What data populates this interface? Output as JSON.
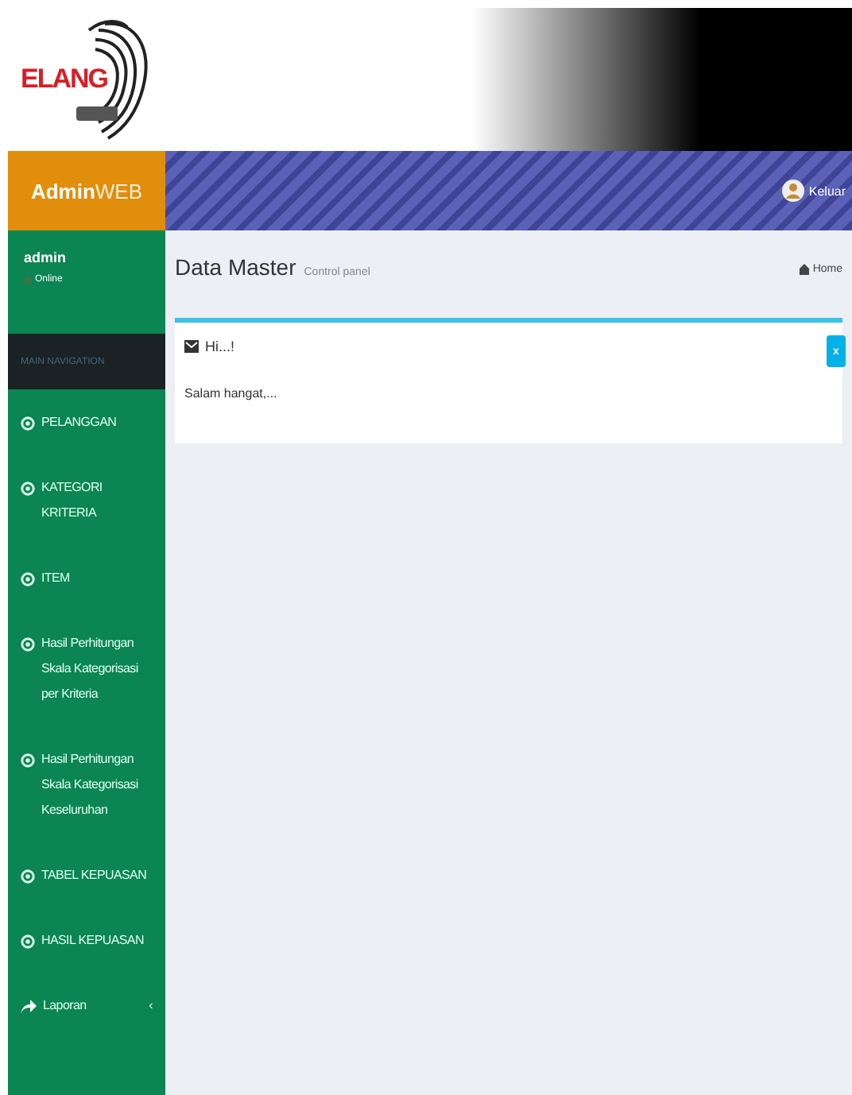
{
  "banner": {
    "logo_text": "ELANG"
  },
  "navbar": {
    "brand_bold": "Admin",
    "brand_light": "WEB",
    "user_label": "Keluar"
  },
  "sidebar": {
    "user": {
      "name": "admin",
      "status": "Online",
      "online": true
    },
    "header": "MAIN NAVIGATION",
    "items": [
      {
        "kind": "circle",
        "label": "PELANGGAN"
      },
      {
        "kind": "circle",
        "label": "KATEGORI KRITERIA"
      },
      {
        "kind": "circle",
        "label": "ITEM"
      },
      {
        "kind": "circle",
        "label": "Hasil Perhitungan Skala Kategorisasi per Kriteria"
      },
      {
        "kind": "circle",
        "label": "Hasil Perhitungan Skala Kategorisasi Keseluruhan"
      },
      {
        "kind": "circle",
        "label": "TABEL KEPUASAN"
      },
      {
        "kind": "circle",
        "label": "HASIL KEPUASAN"
      },
      {
        "kind": "share",
        "label": "Laporan",
        "caret": "‹"
      }
    ]
  },
  "content": {
    "title": "Data Master",
    "subtitle": "Control panel",
    "breadcrumb": "Home",
    "alert": {
      "title": "Hi...!",
      "message": "Salam hangat,...",
      "close": "x"
    }
  }
}
